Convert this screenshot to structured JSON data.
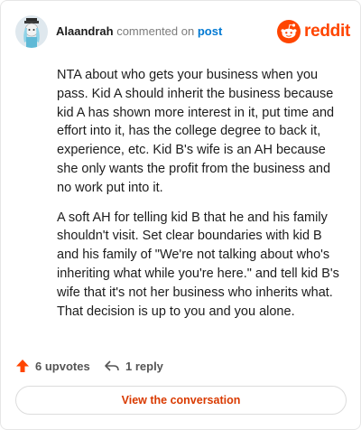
{
  "comment": {
    "username": "Alaandrah",
    "action_text": "commented on",
    "post_link": "post",
    "paragraphs": [
      "NTA about who gets your business when you pass. Kid A should inherit the business because kid A has shown more interest in it, put time and effort into it, has the college degree to back it, experience, etc. Kid B's wife is an AH because she only wants the profit from the business and no work put into it.",
      "A soft AH for telling kid B that he and his family shouldn't visit. Set clear boundaries with kid B and his family of \"We're not talking about who's inheriting what while you're here.\" and tell kid B's wife that it's not her business who inherits what. That decision is up to you and you alone."
    ]
  },
  "brand": {
    "name": "reddit",
    "icon": "reddit-logo-icon",
    "color": "#ff4500"
  },
  "actions": {
    "upvotes_label": "6 upvotes",
    "upvote_icon": "upvote-arrow-icon",
    "replies_label": "1 reply",
    "reply_icon": "reply-arrow-icon"
  },
  "cta": {
    "label": "View the conversation",
    "color": "#d93a00"
  }
}
